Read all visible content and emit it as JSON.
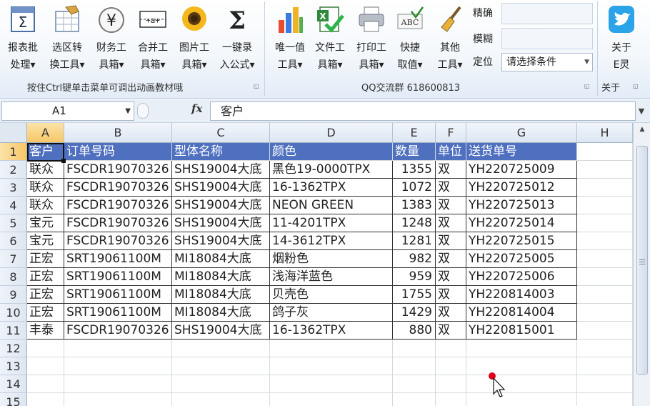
{
  "ribbon": {
    "buttons": [
      {
        "line1": "报表批",
        "line2": "处理▾",
        "icon": "report-batch-icon"
      },
      {
        "line1": "选区转",
        "line2": "换工具▾",
        "icon": "selection-convert-icon"
      },
      {
        "line1": "财务工",
        "line2": "具箱▾",
        "icon": "yen-icon"
      },
      {
        "line1": "合并工",
        "line2": "具箱▾",
        "icon": "merge-icon"
      },
      {
        "line1": "图片工",
        "line2": "具箱▾",
        "icon": "sunflower-picture-icon"
      },
      {
        "line1": "一键录",
        "line2": "入公式▾",
        "icon": "sigma-icon"
      },
      {
        "line1": "唯一值",
        "line2": "工具▾",
        "icon": "bar-chart-icon"
      },
      {
        "line1": "文件工",
        "line2": "具箱▾",
        "icon": "excel-file-icon"
      },
      {
        "line1": "打印工",
        "line2": "具箱▾",
        "icon": "printer-icon"
      },
      {
        "line1": "快捷",
        "line2": "取值▾",
        "icon": "abc-check-icon"
      },
      {
        "line1": "其他",
        "line2": "工具▾",
        "icon": "brush-icon"
      },
      {
        "line1": "关于",
        "line2": "E灵",
        "icon": "twitter-bird-icon"
      }
    ],
    "group1_title": "按住Ctrl键单击菜单可调出动画教材哦",
    "group2_title": "QQ交流群  618600813",
    "group3_title": "关于",
    "side_labels": {
      "exact": "精确",
      "fuzzy": "模糊",
      "locate": "定位"
    },
    "condition_placeholder": "请选择条件"
  },
  "formula_bar": {
    "name_box": "A1",
    "fx_label": "fx",
    "content": "客户"
  },
  "sheet": {
    "col_headers": [
      "A",
      "B",
      "C",
      "D",
      "E",
      "F",
      "G",
      "H"
    ],
    "row_numbers": [
      "1",
      "2",
      "3",
      "4",
      "5",
      "6",
      "7",
      "8",
      "9",
      "10",
      "11",
      "12",
      "13",
      "14",
      "15"
    ],
    "header": [
      "客户",
      "订单号码",
      "型体名称",
      "颜色",
      "数量",
      "单位",
      "送货单号"
    ],
    "rows": [
      [
        "联众",
        "FSCDR19070326",
        "SHS19004大底",
        "黑色19-0000TPX",
        "1355",
        "双",
        "YH220725009"
      ],
      [
        "联众",
        "FSCDR19070326",
        "SHS19004大底",
        "16-1362TPX",
        "1072",
        "双",
        "YH220725012"
      ],
      [
        "联众",
        "FSCDR19070326",
        "SHS19004大底",
        "NEON GREEN",
        "1383",
        "双",
        "YH220725013"
      ],
      [
        "宝元",
        "FSCDR19070326",
        "SHS19004大底",
        "11-4201TPX",
        "1248",
        "双",
        "YH220725014"
      ],
      [
        "宝元",
        "FSCDR19070326",
        "SHS19004大底",
        "14-3612TPX",
        "1281",
        "双",
        "YH220725015"
      ],
      [
        "正宏",
        "SRT19061100M",
        "MI18084大底",
        "烟粉色",
        "982",
        "双",
        "YH220725005"
      ],
      [
        "正宏",
        "SRT19061100M",
        "MI18084大底",
        "浅海洋蓝色",
        "959",
        "双",
        "YH220725006"
      ],
      [
        "正宏",
        "SRT19061100M",
        "MI18084大底",
        "贝壳色",
        "1755",
        "双",
        "YH220814003"
      ],
      [
        "正宏",
        "SRT19061100M",
        "MI18084大底",
        "鸽子灰",
        "1429",
        "双",
        "YH220814004"
      ],
      [
        "丰泰",
        "FSCDR19070326",
        "SHS19004大底",
        "16-1362TPX",
        "880",
        "双",
        "YH220815001"
      ]
    ]
  },
  "colors": {
    "header_fill": "#4f6fbf",
    "header_text": "#ffffff",
    "selection_highlight": "#f6c667",
    "cursor_dot": "#e0001b"
  }
}
